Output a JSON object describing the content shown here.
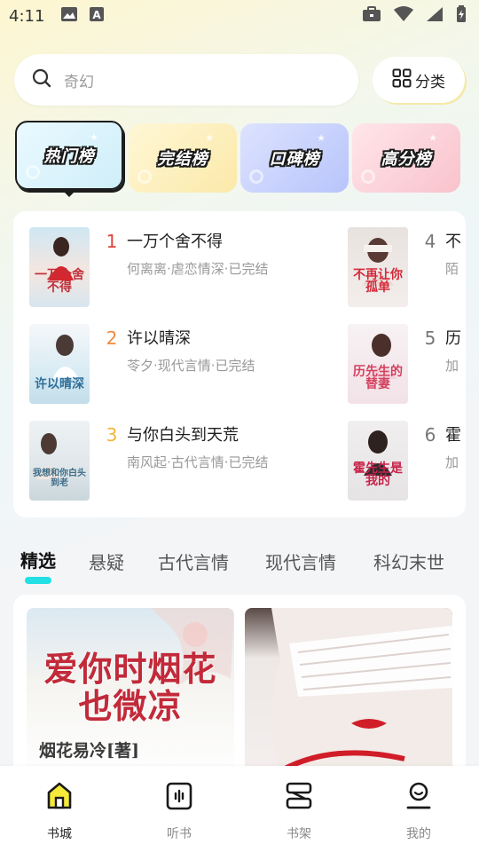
{
  "status_bar": {
    "time": "4:11"
  },
  "search": {
    "placeholder": "奇幻",
    "category_label": "分类"
  },
  "rank_tabs": [
    {
      "label": "热门榜"
    },
    {
      "label": "完结榜"
    },
    {
      "label": "口碑榜"
    },
    {
      "label": "高分榜"
    }
  ],
  "ranking": {
    "left": [
      {
        "rank": "1",
        "title": "一万个舍不得",
        "meta": "何离离·虐恋情深·已完结",
        "cover_text": "一万个舍不得",
        "rank_color": "#e0433c"
      },
      {
        "rank": "2",
        "title": "许以晴深",
        "meta": "苓夕·现代言情·已完结",
        "cover_text": "许以晴深",
        "rank_color": "#f08a3c"
      },
      {
        "rank": "3",
        "title": "与你白头到天荒",
        "meta": "南风起·古代言情·已完结",
        "cover_text": "我想和你白头到老",
        "rank_color": "#f2b53a"
      }
    ],
    "right": [
      {
        "rank": "4",
        "title": "不",
        "meta": "陌",
        "cover_text": "不再让你孤单",
        "rank_color": "#777777"
      },
      {
        "rank": "5",
        "title": "历",
        "meta": "加",
        "cover_text": "历先生的替妻",
        "rank_color": "#777777"
      },
      {
        "rank": "6",
        "title": "霍",
        "meta": "加",
        "cover_text": "霍先生是我的",
        "rank_color": "#777777"
      }
    ]
  },
  "genre_tabs": [
    "精选",
    "悬疑",
    "古代言情",
    "现代言情",
    "科幻末世"
  ],
  "featured": {
    "cover1_title": "爱你时烟花也微凉",
    "cover1_author": "烟花易冷[著]"
  },
  "bottom_nav": [
    {
      "label": "书城",
      "icon": "home-icon",
      "active": true
    },
    {
      "label": "听书",
      "icon": "audio-icon",
      "active": false
    },
    {
      "label": "书架",
      "icon": "bookshelf-icon",
      "active": false
    },
    {
      "label": "我的",
      "icon": "profile-icon",
      "active": false
    }
  ],
  "colors": {
    "accent": "#22e0e4",
    "nav_active": "#f5e93a"
  }
}
